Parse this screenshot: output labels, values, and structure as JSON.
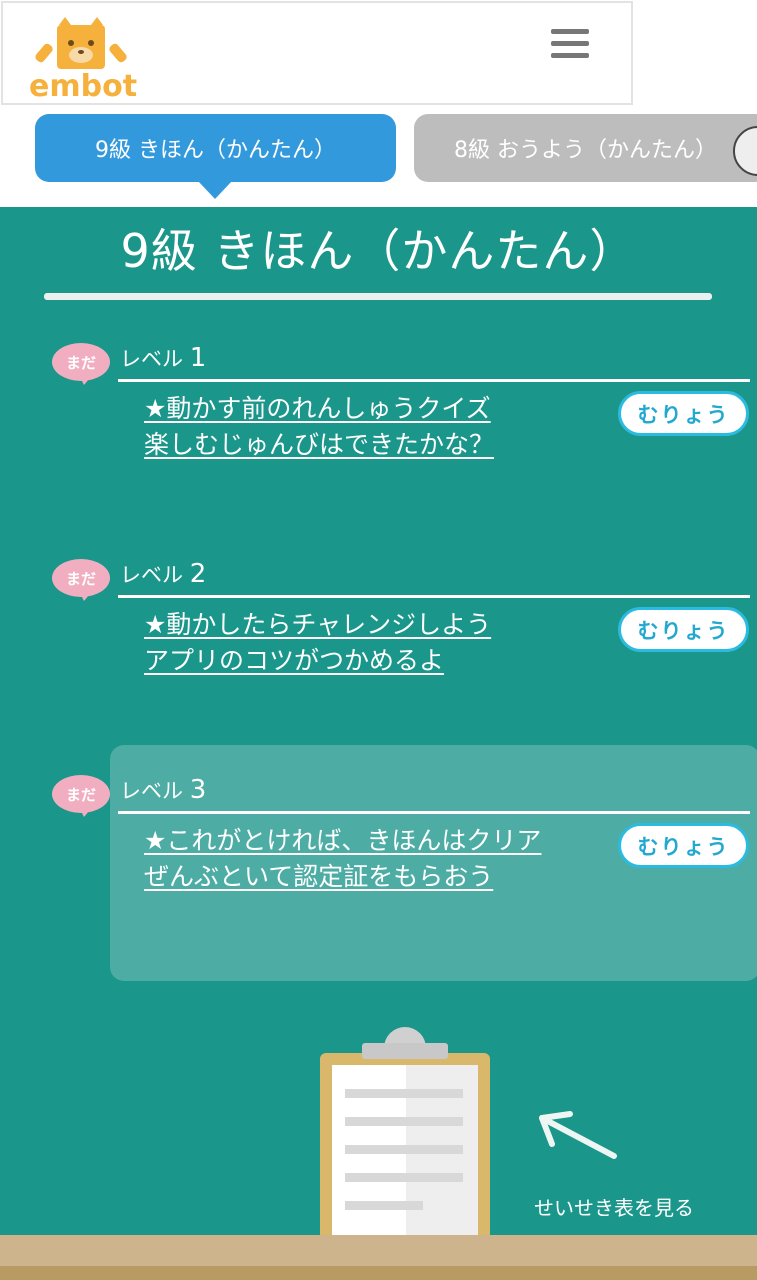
{
  "header": {
    "logo_text": "embot",
    "menu_icon": "hamburger-menu-icon"
  },
  "tabs": [
    {
      "label": "9級 きほん（かんたん）",
      "active": true
    },
    {
      "label": "8級 おうよう（かんたん）",
      "active": false
    }
  ],
  "board": {
    "title": "9級 きほん（かんたん）",
    "levels": [
      {
        "status": "まだ",
        "label": "レベル",
        "number": "1",
        "link_line1": "★動かす前のれんしゅうクイズ",
        "link_line2": "楽しむじゅんびはできたかな？",
        "difficulty": "むりょう"
      },
      {
        "status": "まだ",
        "label": "レベル",
        "number": "2",
        "link_line1": "★動かしたらチャレンジしよう",
        "link_line2": "アプリのコツがつかめるよ",
        "difficulty": "むりょう"
      },
      {
        "status": "まだ",
        "label": "レベル",
        "number": "3",
        "link_line1": "★これがとければ、きほんはクリア",
        "link_line2": "ぜんぶといて認定証をもらおう",
        "difficulty": "むりょう"
      }
    ],
    "report_link": "せいせき表を見る"
  },
  "colors": {
    "board": "#1b968b",
    "active_tab": "#3399dd",
    "inactive_tab": "#bdbdbd",
    "badge_border": "#2bbbe0",
    "status_bubble": "#f2aec1",
    "logo": "#f5b13b"
  }
}
